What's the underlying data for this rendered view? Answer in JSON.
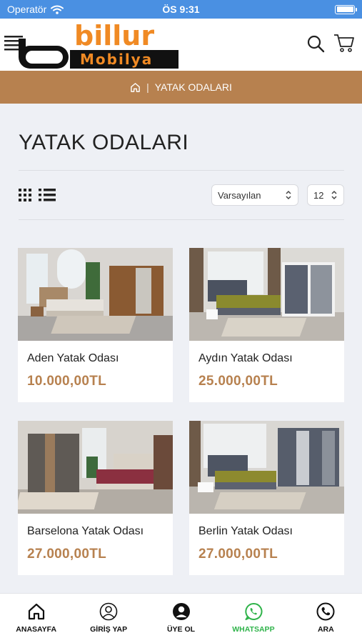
{
  "status_bar": {
    "carrier": "Operatör",
    "time": "ÖS 9:31"
  },
  "header": {
    "logo_top": "billur",
    "logo_bottom": "Mobilya"
  },
  "breadcrumb": {
    "separator": "|",
    "current": "YATAK ODALARI"
  },
  "page": {
    "title": "YATAK ODALARI"
  },
  "toolbar": {
    "sort_value": "Varsayılan",
    "count_value": "12"
  },
  "products": [
    {
      "name": "Aden Yatak Odası",
      "price": "10.000,00TL"
    },
    {
      "name": "Aydın Yatak Odası",
      "price": "25.000,00TL"
    },
    {
      "name": "Barselona Yatak Odası",
      "price": "27.000,00TL"
    },
    {
      "name": "Berlin Yatak Odası",
      "price": "27.000,00TL"
    }
  ],
  "bottom_nav": [
    {
      "label": "ANASAYFA",
      "icon": "home-icon"
    },
    {
      "label": "GİRİŞ YAP",
      "icon": "user-outline-icon"
    },
    {
      "label": "ÜYE OL",
      "icon": "user-filled-icon"
    },
    {
      "label": "WHATSAPP",
      "icon": "whatsapp-icon"
    },
    {
      "label": "ARA",
      "icon": "phone-icon"
    }
  ],
  "colors": {
    "status_bar": "#4a90e2",
    "accent": "#b7814f",
    "logo_orange": "#f08a24",
    "whatsapp": "#2fb34a",
    "page_bg": "#eef0f5"
  }
}
